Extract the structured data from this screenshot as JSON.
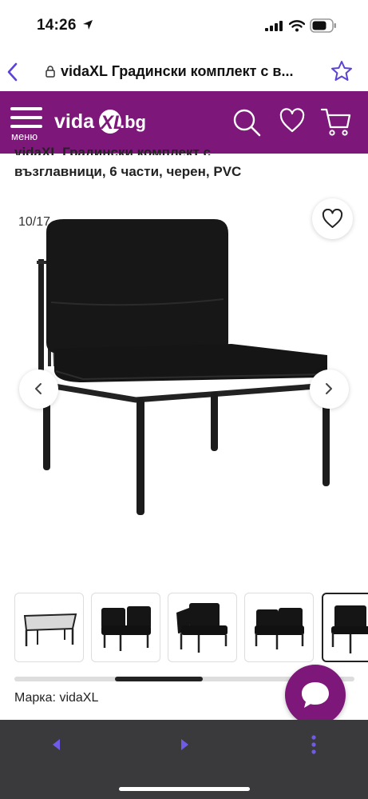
{
  "status_bar": {
    "time": "14:26"
  },
  "browser": {
    "page_title": "vidaXL Градински комплект с в..."
  },
  "header": {
    "menu_label": "меню",
    "logo_text": "vidaXL.bg"
  },
  "product": {
    "title_line1": "vidaXL Градински комплект с",
    "title_line2": "възглавници, 6 части, черен, PVC",
    "brand": "Марка: vidaXL"
  },
  "gallery": {
    "counter": "10/17",
    "thumbnails": [
      "thumb-table",
      "thumb-corner-chair",
      "thumb-corner-chair-side",
      "thumb-corner-chair-back",
      "thumb-middle-chair"
    ],
    "active_index": 4
  },
  "colors": {
    "brand": "#7d1779",
    "toolbar": "#3a3a3c",
    "accent": "#7b5cf0"
  },
  "icons": [
    "location-arrow-icon",
    "signal-icon",
    "wifi-icon",
    "battery-icon",
    "back-chevron-icon",
    "lock-icon",
    "star-icon",
    "menu-icon",
    "search-icon",
    "heart-icon",
    "cart-icon",
    "chevron-left-icon",
    "chevron-right-icon",
    "chat-icon",
    "more-icon"
  ]
}
